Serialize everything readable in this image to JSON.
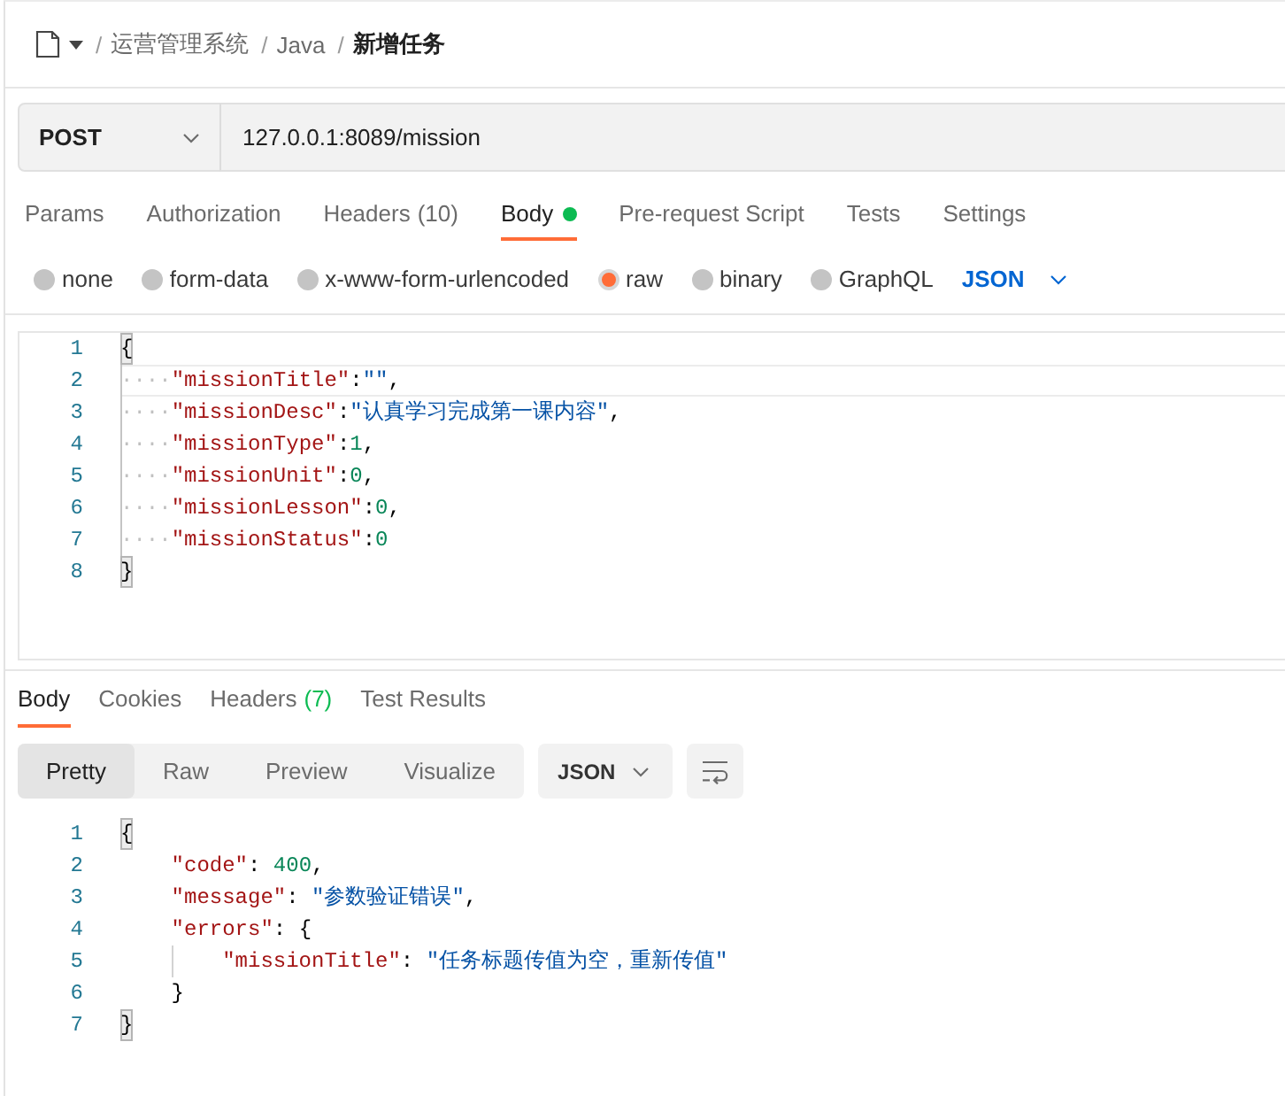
{
  "breadcrumb": [
    {
      "separator": "/",
      "text": "运营管理系统",
      "current": false
    },
    {
      "separator": "/",
      "text": "Java",
      "current": false
    },
    {
      "separator": "/",
      "text": "新增任务",
      "current": true
    }
  ],
  "request": {
    "method": "POST",
    "url": "127.0.0.1:8089/mission"
  },
  "request_tabs": [
    {
      "label": "Params",
      "selected": false,
      "indicator": false
    },
    {
      "label": "Authorization",
      "selected": false,
      "indicator": false
    },
    {
      "label": "Headers",
      "count": "(10)",
      "count_accent": false,
      "selected": false,
      "indicator": false
    },
    {
      "label": "Body",
      "selected": true,
      "indicator": true
    },
    {
      "label": "Pre-request Script",
      "selected": false,
      "indicator": false
    },
    {
      "label": "Tests",
      "selected": false,
      "indicator": false
    },
    {
      "label": "Settings",
      "selected": false,
      "indicator": false
    }
  ],
  "body_types": [
    {
      "label": "none",
      "selected": false
    },
    {
      "label": "form-data",
      "selected": false
    },
    {
      "label": "x-www-form-urlencoded",
      "selected": false
    },
    {
      "label": "raw",
      "selected": true
    },
    {
      "label": "binary",
      "selected": false
    },
    {
      "label": "GraphQL",
      "selected": false
    }
  ],
  "body_format": "JSON",
  "request_editor": {
    "lines": [
      {
        "number": "1",
        "current": false,
        "tokens": [
          {
            "kind": "bracket",
            "text": "{",
            "matched": true
          }
        ]
      },
      {
        "number": "2",
        "current": true,
        "tokens": [
          {
            "kind": "whitespace",
            "text": "····"
          },
          {
            "kind": "key",
            "text": "\"missionTitle\""
          },
          {
            "kind": "punct",
            "text": ":"
          },
          {
            "kind": "string",
            "text": "\"\""
          },
          {
            "kind": "punct",
            "text": ","
          }
        ]
      },
      {
        "number": "3",
        "current": false,
        "tokens": [
          {
            "kind": "whitespace",
            "text": "····"
          },
          {
            "kind": "key",
            "text": "\"missionDesc\""
          },
          {
            "kind": "punct",
            "text": ":"
          },
          {
            "kind": "string",
            "text": "\"认真学习完成第一课内容\""
          },
          {
            "kind": "punct",
            "text": ","
          }
        ]
      },
      {
        "number": "4",
        "current": false,
        "tokens": [
          {
            "kind": "whitespace",
            "text": "····"
          },
          {
            "kind": "key",
            "text": "\"missionType\""
          },
          {
            "kind": "punct",
            "text": ":"
          },
          {
            "kind": "number",
            "text": "1"
          },
          {
            "kind": "punct",
            "text": ","
          }
        ]
      },
      {
        "number": "5",
        "current": false,
        "tokens": [
          {
            "kind": "whitespace",
            "text": "····"
          },
          {
            "kind": "key",
            "text": "\"missionUnit\""
          },
          {
            "kind": "punct",
            "text": ":"
          },
          {
            "kind": "number",
            "text": "0"
          },
          {
            "kind": "punct",
            "text": ","
          }
        ]
      },
      {
        "number": "6",
        "current": false,
        "tokens": [
          {
            "kind": "whitespace",
            "text": "····"
          },
          {
            "kind": "key",
            "text": "\"missionLesson\""
          },
          {
            "kind": "punct",
            "text": ":"
          },
          {
            "kind": "number",
            "text": "0"
          },
          {
            "kind": "punct",
            "text": ","
          }
        ]
      },
      {
        "number": "7",
        "current": false,
        "tokens": [
          {
            "kind": "whitespace",
            "text": "····"
          },
          {
            "kind": "key",
            "text": "\"missionStatus\""
          },
          {
            "kind": "punct",
            "text": ":"
          },
          {
            "kind": "number",
            "text": "0"
          }
        ]
      },
      {
        "number": "8",
        "current": false,
        "tokens": [
          {
            "kind": "bracket",
            "text": "}",
            "matched": true
          }
        ]
      }
    ]
  },
  "response_tabs": [
    {
      "label": "Body",
      "selected": true
    },
    {
      "label": "Cookies",
      "selected": false
    },
    {
      "label": "Headers",
      "count": "(7)",
      "count_accent": true,
      "selected": false
    },
    {
      "label": "Test Results",
      "selected": false
    }
  ],
  "view_modes": [
    {
      "label": "Pretty",
      "selected": true
    },
    {
      "label": "Raw",
      "selected": false
    },
    {
      "label": "Preview",
      "selected": false
    },
    {
      "label": "Visualize",
      "selected": false
    }
  ],
  "response_format": "JSON",
  "response_body": {
    "lines": [
      {
        "number": "1",
        "tokens": [
          {
            "kind": "bracket",
            "text": "{",
            "matched": true
          }
        ],
        "children": [
          {
            "number": "2",
            "tokens": [
              {
                "kind": "key",
                "text": "\"code\""
              },
              {
                "kind": "punct",
                "text": ": "
              },
              {
                "kind": "number",
                "text": "400"
              },
              {
                "kind": "punct",
                "text": ","
              }
            ]
          },
          {
            "number": "3",
            "tokens": [
              {
                "kind": "key",
                "text": "\"message\""
              },
              {
                "kind": "punct",
                "text": ": "
              },
              {
                "kind": "string",
                "text": "\"参数验证错误\""
              },
              {
                "kind": "punct",
                "text": ","
              }
            ]
          },
          {
            "number": "4",
            "tokens": [
              {
                "kind": "key",
                "text": "\"errors\""
              },
              {
                "kind": "punct",
                "text": ": "
              },
              {
                "kind": "bracket",
                "text": "{",
                "matched": false
              }
            ],
            "children": [
              {
                "number": "5",
                "tokens": [
                  {
                    "kind": "key",
                    "text": "\"missionTitle\""
                  },
                  {
                    "kind": "punct",
                    "text": ": "
                  },
                  {
                    "kind": "string",
                    "text": "\"任务标题传值为空，重新传值\""
                  }
                ]
              }
            ]
          },
          {
            "number": "6",
            "tokens": [
              {
                "kind": "bracket",
                "text": "}",
                "matched": false
              }
            ]
          }
        ]
      },
      {
        "number": "7",
        "tokens": [
          {
            "kind": "bracket",
            "text": "}",
            "matched": true
          }
        ]
      }
    ]
  }
}
